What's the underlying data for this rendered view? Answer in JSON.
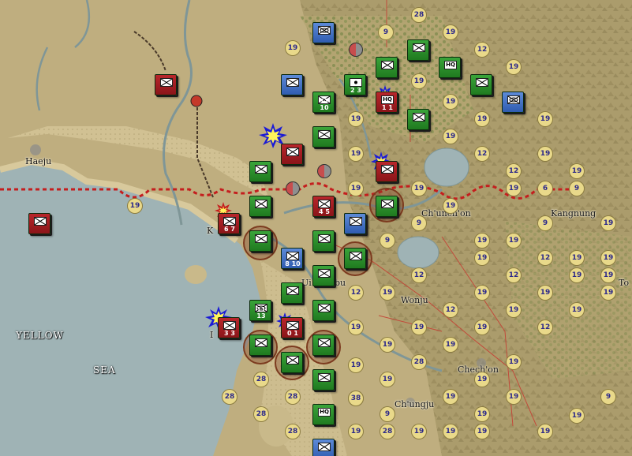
{
  "map": {
    "place_names": {
      "haeju": "Haeju",
      "kaesong": "K",
      "chunchon": "Ch'unch'on",
      "kangnung": "Kangnung",
      "wonju": "Wonju",
      "uijongbu": "Ui",
      "uijongbu_tail": "bu",
      "chechon": "Chech'on",
      "chungju": "Ch'ungju",
      "inchon": "I",
      "to_partial": "To",
      "yellow": "YELLOW",
      "sea": "SEA"
    },
    "colors": {
      "terrain_clear": "#b9a879",
      "water": "#9fb3b5",
      "front_line": "#c41e1e",
      "nk_counter": "#9e1c20",
      "un_counter": "#2e8f2e",
      "us_counter": "#4a77c9",
      "badge": "#e9d98a"
    }
  },
  "counters": {
    "c1": {
      "cv": "",
      "icon": "armor-icon"
    },
    "c2": {
      "cv": "",
      "icon": "infantry-icon"
    },
    "c3": {
      "cv": "",
      "icon": "infantry-icon"
    },
    "c4": {
      "cv": "",
      "icon": "infantry-icon"
    },
    "c5": {
      "cv": "",
      "icon": "infantry-icon"
    },
    "c6": {
      "cv": "2 3",
      "icon": "artillery-icon"
    },
    "c7": {
      "cv": "11 10",
      "icon": "infantry-icon"
    },
    "c8": {
      "cv": "HQ",
      "icon": "hq-icon",
      "sub": "1 1"
    },
    "c9": {
      "cv": "",
      "icon": "infantry-icon"
    },
    "c10": {
      "cv": "",
      "icon": "hq-icon",
      "label": "HQ"
    },
    "c11": {
      "cv": "",
      "icon": "infantry-icon"
    },
    "c12": {
      "cv": "",
      "icon": "armor-icon"
    },
    "c13": {
      "cv": "4 5",
      "icon": "infantry-icon"
    },
    "c14": {
      "cv": "6 7",
      "icon": "infantry-icon"
    },
    "c15": {
      "cv": "8 10",
      "icon": "infantry-icon"
    },
    "c16": {
      "cv": "11 13",
      "icon": "armor-icon"
    },
    "c17": {
      "cv": "3 3",
      "icon": "infantry-icon"
    },
    "c18": {
      "cv": "0 1",
      "icon": "infantry-icon"
    },
    "c19": {
      "cv": "",
      "icon": "hq-icon",
      "label": "HQ"
    }
  },
  "badges": [
    "28",
    "9",
    "19",
    "19",
    "12",
    "19",
    "19",
    "19",
    "19",
    "19",
    "19",
    "19",
    "19",
    "12",
    "19",
    "19",
    "19",
    "19",
    "12",
    "19",
    "19",
    "9",
    "19",
    "19",
    "6",
    "9",
    "19",
    "9",
    "19",
    "19",
    "12",
    "19",
    "19",
    "9",
    "19",
    "12",
    "19",
    "19",
    "12",
    "19",
    "12",
    "19",
    "19",
    "19",
    "19",
    "19",
    "12",
    "19",
    "19",
    "19",
    "12",
    "19",
    "19",
    "28",
    "19",
    "19",
    "19",
    "19",
    "19",
    "19",
    "19",
    "19",
    "28",
    "38",
    "28",
    "19",
    "19",
    "28",
    "28",
    "19",
    "19",
    "28",
    "19",
    "28",
    "19",
    "19",
    "9",
    "19",
    "9"
  ]
}
